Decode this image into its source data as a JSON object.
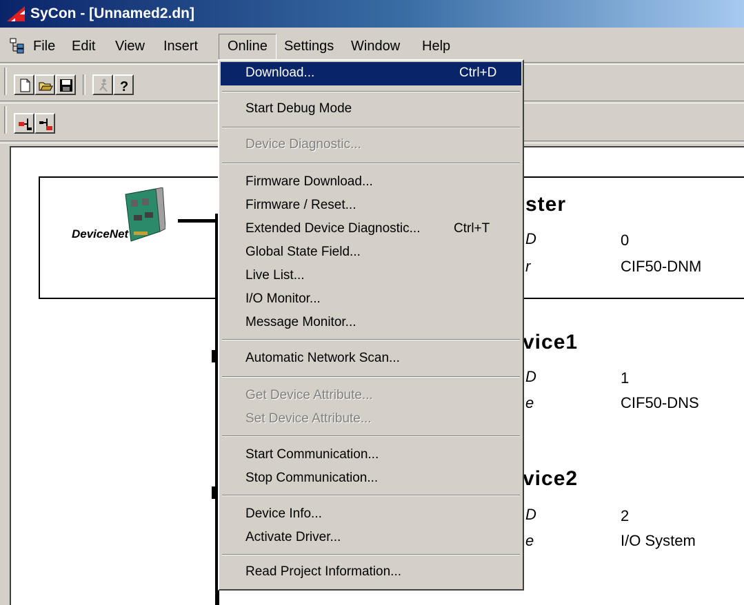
{
  "window": {
    "title": "SyCon - [Unnamed2.dn]"
  },
  "menubar": {
    "items": [
      "File",
      "Edit",
      "View",
      "Insert",
      "Online",
      "Settings",
      "Window",
      "Help"
    ],
    "active": "Online"
  },
  "toolbar": {
    "buttons": [
      "new-document",
      "open-folder",
      "save",
      "run-disabled",
      "help"
    ],
    "buttons2": [
      "network-left",
      "network-right"
    ]
  },
  "online_menu": {
    "groups": [
      [
        {
          "label": "Download...",
          "shortcut": "Ctrl+D",
          "selected": true
        }
      ],
      [
        {
          "label": "Start Debug Mode"
        }
      ],
      [
        {
          "label": "Device Diagnostic...",
          "disabled": true
        }
      ],
      [
        {
          "label": "Firmware Download..."
        },
        {
          "label": "Firmware / Reset..."
        },
        {
          "label": "Extended Device Diagnostic...",
          "shortcut": "Ctrl+T"
        },
        {
          "label": "Global State Field..."
        },
        {
          "label": "Live List..."
        },
        {
          "label": "I/O Monitor..."
        },
        {
          "label": "Message Monitor..."
        }
      ],
      [
        {
          "label": "Automatic Network Scan..."
        }
      ],
      [
        {
          "label": "Get Device Attribute...",
          "disabled": true
        },
        {
          "label": "Set Device Attribute...",
          "disabled": true
        }
      ],
      [
        {
          "label": "Start Communication..."
        },
        {
          "label": "Stop Communication..."
        }
      ],
      [
        {
          "label": "Device Info..."
        },
        {
          "label": "Activate Driver..."
        }
      ],
      [
        {
          "label": "Read Project Information..."
        }
      ]
    ]
  },
  "network": {
    "logo_text": "DeviceNet",
    "master": {
      "title_fragment": "ster",
      "row1_label": "D",
      "row1_value": "0",
      "row2_label": "r",
      "row2_value": "CIF50-DNM"
    },
    "device1": {
      "title_fragment": "vice1",
      "row1_label": "D",
      "row1_value": "1",
      "row2_label": "e",
      "row2_value": "CIF50-DNS"
    },
    "device2": {
      "title_fragment": "vice2",
      "row1_label": "D",
      "row1_value": "2",
      "row2_label": "e",
      "row2_value": "I/O System"
    }
  },
  "colors": {
    "menu_highlight": "#0a246a",
    "titlebar_start": "#0a246a",
    "titlebar_end": "#a6caf0",
    "face": "#d4d0c8"
  }
}
